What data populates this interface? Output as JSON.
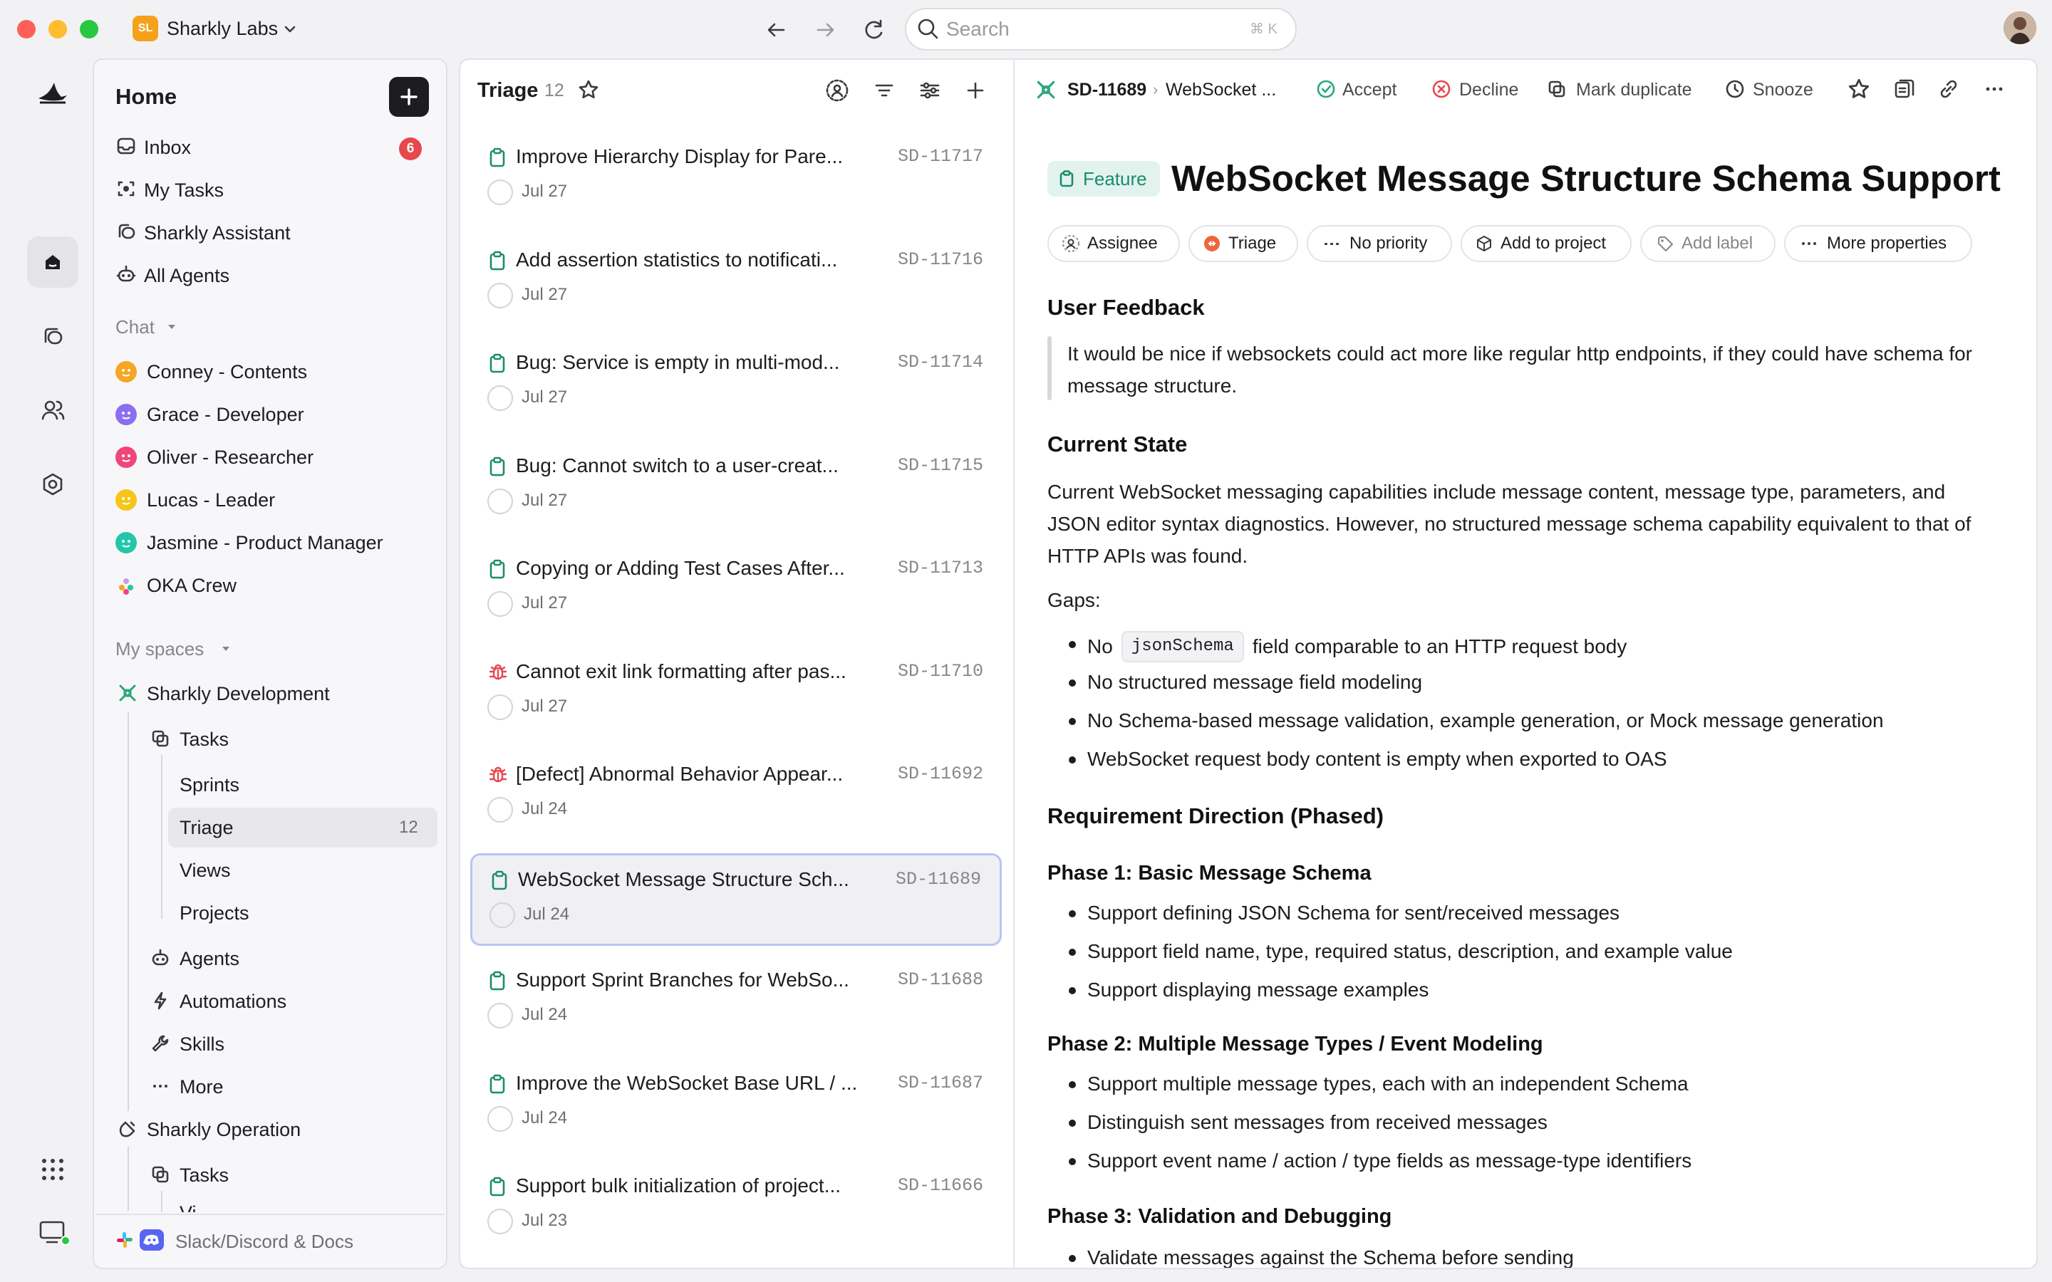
{
  "titlebar": {
    "workspace_initials": "SL",
    "workspace_name": "Sharkly Labs",
    "search_placeholder": "Search",
    "search_shortcut": "⌘ K"
  },
  "sidebar": {
    "home_title": "Home",
    "nav": [
      {
        "label": "Inbox",
        "icon": "inbox-icon",
        "badge": "6"
      },
      {
        "label": "My Tasks",
        "icon": "target-icon"
      },
      {
        "label": "Sharkly Assistant",
        "icon": "chat-icon"
      },
      {
        "label": "All Agents",
        "icon": "robot-icon"
      }
    ],
    "chat_section": "Chat",
    "chats": [
      {
        "label": "Conney - Contents",
        "color": "#f5a623"
      },
      {
        "label": "Grace - Developer",
        "color": "#8b6ff0"
      },
      {
        "label": "Oliver - Researcher",
        "color": "#f0467a"
      },
      {
        "label": "Lucas - Leader",
        "color": "#f5c518"
      },
      {
        "label": "Jasmine - Product Manager",
        "color": "#22c7a9"
      },
      {
        "label": "OKA Crew",
        "color": "#c9a0d8"
      }
    ],
    "spaces_section": "My spaces",
    "space1": {
      "name": "Sharkly Development",
      "tasks": "Tasks",
      "sub": [
        "Sprints",
        "Triage",
        "Views",
        "Projects"
      ],
      "triage_count": "12",
      "extra": [
        "Agents",
        "Automations",
        "Skills",
        "More"
      ]
    },
    "space2": {
      "name": "Sharkly Operation",
      "tasks": "Tasks",
      "cut": "Vi"
    },
    "footer": "Slack/Discord & Docs"
  },
  "list": {
    "title": "Triage",
    "count": "12",
    "items": [
      {
        "title": "Improve Hierarchy Display for Pare...",
        "id": "SD-11717",
        "date": "Jul 27",
        "type": "task"
      },
      {
        "title": "Add assertion statistics to notificati...",
        "id": "SD-11716",
        "date": "Jul 27",
        "type": "task"
      },
      {
        "title": "Bug: Service is empty in multi-mod...",
        "id": "SD-11714",
        "date": "Jul 27",
        "type": "task"
      },
      {
        "title": "Bug: Cannot switch to a user-creat...",
        "id": "SD-11715",
        "date": "Jul 27",
        "type": "task"
      },
      {
        "title": "Copying or Adding Test Cases After...",
        "id": "SD-11713",
        "date": "Jul 27",
        "type": "task"
      },
      {
        "title": "Cannot exit link formatting after pas...",
        "id": "SD-11710",
        "date": "Jul 27",
        "type": "bug"
      },
      {
        "title": "[Defect] Abnormal Behavior Appear...",
        "id": "SD-11692",
        "date": "Jul 24",
        "type": "bug"
      },
      {
        "title": "WebSocket Message Structure Sch...",
        "id": "SD-11689",
        "date": "Jul 24",
        "type": "task",
        "selected": true
      },
      {
        "title": "Support Sprint Branches for WebSo...",
        "id": "SD-11688",
        "date": "Jul 24",
        "type": "task"
      },
      {
        "title": "Improve the WebSocket Base URL / ...",
        "id": "SD-11687",
        "date": "Jul 24",
        "type": "task"
      },
      {
        "title": "Support bulk initialization of project...",
        "id": "SD-11666",
        "date": "Jul 23",
        "type": "task"
      }
    ]
  },
  "detail": {
    "breadcrumb_id": "SD-11689",
    "breadcrumb_sep": "›",
    "breadcrumb_title": "WebSocket ...",
    "actions": {
      "accept": "Accept",
      "decline": "Decline",
      "duplicate": "Mark duplicate",
      "snooze": "Snooze"
    },
    "type_label": "Feature",
    "title": "WebSocket Message Structure Schema Support",
    "props": {
      "assignee": "Assignee",
      "status": "Triage",
      "priority": "No priority",
      "project": "Add to project",
      "label": "Add label",
      "more": "More properties"
    },
    "s1_heading": "User Feedback",
    "quote": "It would be nice if websockets could act more like regular http endpoints, if they could have schema for message structure.",
    "s2_heading": "Current State",
    "current_state": "Current WebSocket messaging capabilities include message content, message type, parameters, and JSON editor syntax diagnostics. However, no structured message schema capability equivalent to that of HTTP APIs was found.",
    "gaps_label": "Gaps:",
    "gap1_pre": "No",
    "gap1_code": "jsonSchema",
    "gap1_post": "field comparable to an HTTP request body",
    "gaps": [
      "No structured message field modeling",
      "No Schema-based message validation, example generation, or Mock message generation",
      "WebSocket request body content is empty when exported to OAS"
    ],
    "s3_heading": "Requirement Direction (Phased)",
    "phase1": "Phase 1: Basic Message Schema",
    "phase1_items": [
      "Support defining JSON Schema for sent/received messages",
      "Support field name, type, required status, description, and example value",
      "Support displaying message examples"
    ],
    "phase2": "Phase 2: Multiple Message Types / Event Modeling",
    "phase2_items": [
      "Support multiple message types, each with an independent Schema",
      "Distinguish sent messages from received messages",
      "Support event name / action / type fields as message-type identifiers"
    ],
    "phase3": "Phase 3: Validation and Debugging",
    "phase3_items": [
      "Validate messages against the Schema before sending"
    ]
  },
  "colors": {
    "accent": "#1a8c6e",
    "badge": "#e5484d",
    "bug": "#e5484d",
    "selected_border": "#b9c3f5"
  }
}
